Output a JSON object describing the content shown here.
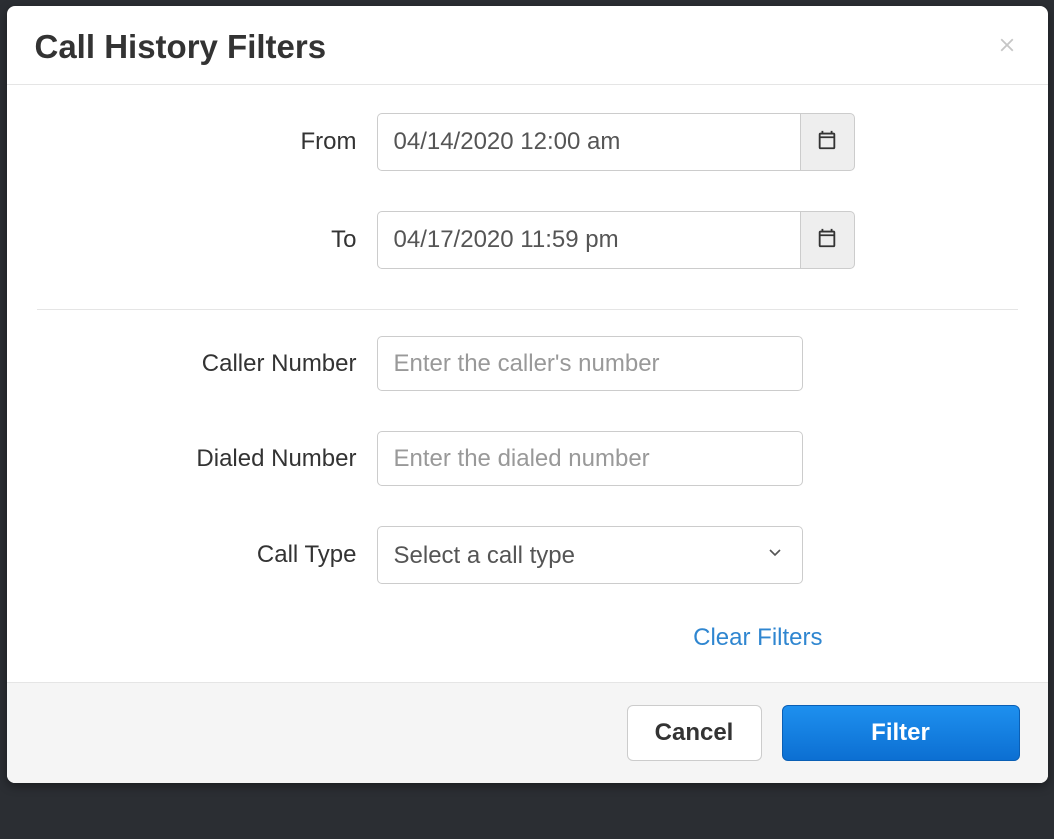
{
  "modal": {
    "title": "Call History Filters",
    "fields": {
      "from": {
        "label": "From",
        "value": "04/14/2020 12:00 am"
      },
      "to": {
        "label": "To",
        "value": "04/17/2020 11:59 pm"
      },
      "caller_number": {
        "label": "Caller Number",
        "placeholder": "Enter the caller's number"
      },
      "dialed_number": {
        "label": "Dialed Number",
        "placeholder": "Enter the dialed number"
      },
      "call_type": {
        "label": "Call Type",
        "placeholder": "Select a call type"
      }
    },
    "clear_filters_label": "Clear Filters",
    "footer": {
      "cancel_label": "Cancel",
      "filter_label": "Filter"
    }
  }
}
